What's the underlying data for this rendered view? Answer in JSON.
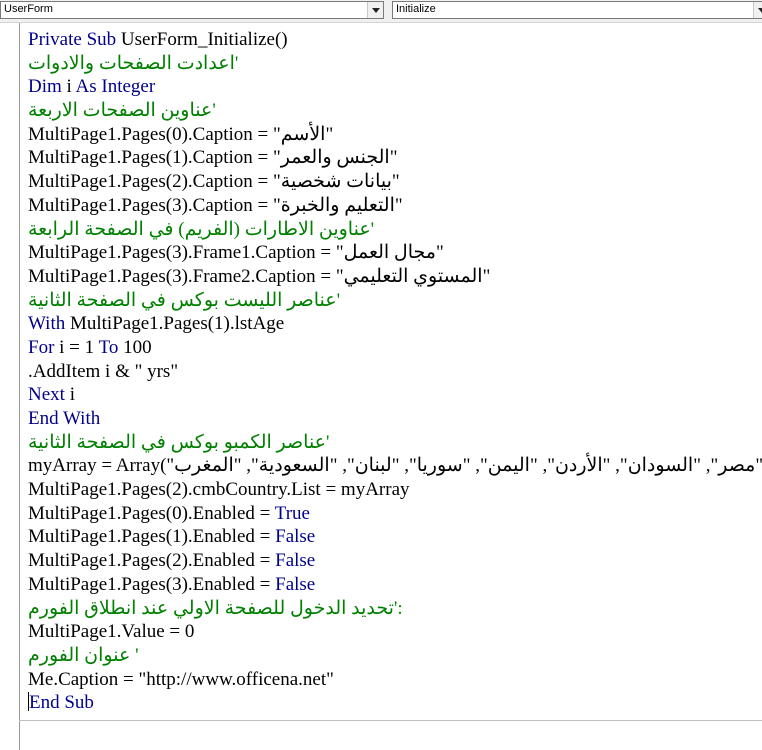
{
  "toolbar": {
    "object_dropdown": "UserForm",
    "procedure_dropdown": "Initialize"
  },
  "code": {
    "l1_kw": "Private Sub",
    "l1_rest": " UserForm_Initialize()",
    "l2_cm": "اعدادت الصفحات والادوات'",
    "l3_kw": "Dim",
    "l3_a": " i ",
    "l3_kw2": "As Integer",
    "l4_cm": "عناوين الصفحات الاربعة'",
    "l5": "MultiPage1.Pages(0).Caption = \"الأسم\"",
    "l6": "MultiPage1.Pages(1).Caption = \"الجنس والعمر\"",
    "l7": "MultiPage1.Pages(2).Caption = \"بيانات شخصية\"",
    "l8": "MultiPage1.Pages(3).Caption = \"التعليم والخبرة\"",
    "l9_cm": "عناوين الاطارات (الفريم) في الصفحة الرابعة'",
    "l10": "MultiPage1.Pages(3).Frame1.Caption = \"مجال العمل\"",
    "l11": "MultiPage1.Pages(3).Frame2.Caption = \"المستوي التعليمي\"",
    "l12_cm": "عناصر الليست بوكس في الصفحة الثانية'",
    "l13_kw": "With",
    "l13_rest": " MultiPage1.Pages(1).lstAge",
    "l14_kw": "For",
    "l14_a": " i = 1 ",
    "l14_kw2": "To",
    "l14_b": " 100",
    "l15": ".AddItem i & \" yrs\"",
    "l16_kw": "Next",
    "l16_rest": " i",
    "l17_kw": "End With",
    "l18_cm": "عناصر الكمبو بوكس في الصفحة الثانية'",
    "l19": "myArray = Array(\"مصر\", \"السودان\", \"الأردن\", \"اليمن\", \"سوريا\", \"لبنان\", \"السعودية\", \"المغرب\",",
    "l20": "MultiPage1.Pages(2).cmbCountry.List = myArray",
    "l21_a": "MultiPage1.Pages(0).Enabled = ",
    "l21_kw": "True",
    "l22_a": "MultiPage1.Pages(1).Enabled = ",
    "l22_kw": "False",
    "l23_a": "MultiPage1.Pages(2).Enabled = ",
    "l23_kw": "False",
    "l24_a": "MultiPage1.Pages(3).Enabled = ",
    "l24_kw": "False",
    "l25_cm": "تحديد الدخول للصفحة الاولي عند انطلاق الفورم':",
    "l26": "MultiPage1.Value = 0",
    "l27_cm": "عنوان الفورم '",
    "l28": "Me.Caption = \"http://www.officena.net\"",
    "l29_kw": "End Sub"
  }
}
